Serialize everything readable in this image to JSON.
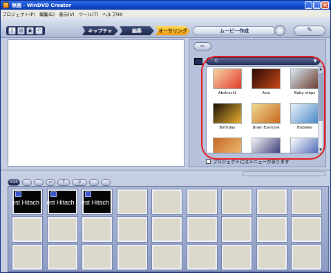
{
  "window": {
    "title": "無題 - WinDVD Creator"
  },
  "menu": [
    "プロジェクト(P)",
    "編集(E)",
    "表示(V)",
    "ツール(T)",
    "ヘルプ(H)"
  ],
  "toolbar": {
    "icons": [
      "new-icon",
      "open-icon",
      "save-icon",
      "undo-icon"
    ],
    "stages": [
      {
        "label": "キャプチャ",
        "active": false
      },
      {
        "label": "編集",
        "active": false
      },
      {
        "label": "オーサリング",
        "active": true
      }
    ],
    "make_movie": "ムービー作成"
  },
  "panel": {
    "combo_value": "C",
    "thumbnails": [
      {
        "caption": "Abstract1",
        "colors": [
          "#f6d6a8",
          "#e23a2a"
        ]
      },
      {
        "caption": "Asia",
        "colors": [
          "#2a0a04",
          "#c8481a"
        ]
      },
      {
        "caption": "Baby steps",
        "colors": [
          "#d8e8f4",
          "#6a3a2a"
        ]
      },
      {
        "caption": "Birthday",
        "colors": [
          "#1a1008",
          "#e8b030"
        ]
      },
      {
        "caption": "Brain Exercise",
        "colors": [
          "#f0d890",
          "#c86a20"
        ]
      },
      {
        "caption": "Bubbles",
        "colors": [
          "#e8f2fa",
          "#4a88c8"
        ]
      },
      {
        "caption": "",
        "colors": [
          "#c86a2a",
          "#f0c070"
        ]
      },
      {
        "caption": "",
        "colors": [
          "#f4f4f8",
          "#2a2a6a"
        ]
      },
      {
        "caption": "",
        "colors": [
          "#ffffff",
          "#3a5ab0"
        ]
      }
    ],
    "checkbox_label": "プロジェクトにはメニューがあります"
  },
  "storyboard": {
    "toolbar_buttons": [
      "EXE",
      "",
      "",
      "",
      "T",
      "",
      ""
    ],
    "clips": [
      "est Hitach",
      "est Hitach",
      "est Hitach"
    ]
  },
  "colors": {
    "highlight": "#e8181c",
    "accent": "#1248c8"
  }
}
